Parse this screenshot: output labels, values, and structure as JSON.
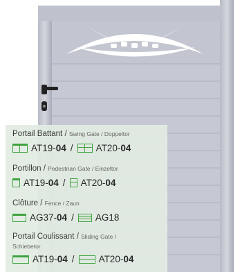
{
  "products": [
    {
      "name": "Portail Battant",
      "translations": "Swing Gate / Doppeltor",
      "models": [
        {
          "code": "AT19-",
          "suffix": "04",
          "icon": "double-swing-icon"
        },
        {
          "code": "AT20-",
          "suffix": "04",
          "icon": "double-swing-striped-icon"
        }
      ]
    },
    {
      "name": "Portillon",
      "translations": "Pedestrian Gate / Einzeltor",
      "models": [
        {
          "code": "AT19-",
          "suffix": "04",
          "icon": "single-gate-icon"
        },
        {
          "code": "AT20-",
          "suffix": "04",
          "icon": "single-gate-striped-icon"
        }
      ]
    },
    {
      "name": "Clôture",
      "translations": "Fence / Zaun",
      "models": [
        {
          "code": "AG37-",
          "suffix": "04",
          "icon": "fence-icon"
        },
        {
          "code": "AG18",
          "suffix": "",
          "icon": "fence-striped-icon"
        }
      ]
    },
    {
      "name": "Portail Coulissant",
      "translations_line1": "Sliding Gate /",
      "translations_line2": "Schiebetor",
      "models": [
        {
          "code": "AT19-",
          "suffix": "04",
          "icon": "sliding-gate-icon"
        },
        {
          "code": "AT20-",
          "suffix": "04",
          "icon": "sliding-gate-striped-icon"
        }
      ]
    }
  ],
  "separator": "/",
  "colors": {
    "gate": "#c3c6d1",
    "accent": "#3fa33f",
    "panel_bg": "#e2ece2"
  }
}
